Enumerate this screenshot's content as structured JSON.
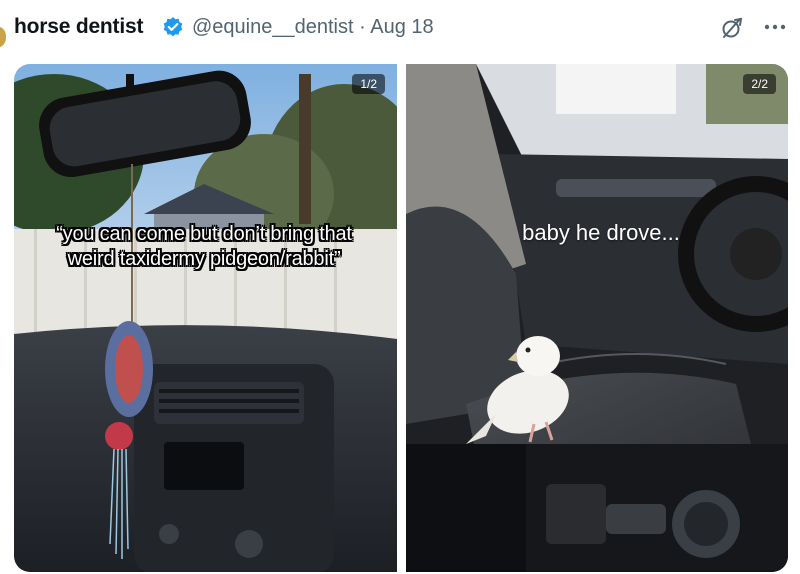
{
  "post": {
    "display_name": "horse dentist",
    "handle": "@equine__dentist",
    "separator": "·",
    "date": "Aug 18",
    "icons": {
      "verified": "verified-badge-icon",
      "grok": "grok-icon",
      "more": "more-options-icon"
    },
    "colors": {
      "verified": "#1d9bf0",
      "handle": "#536471"
    }
  },
  "media": {
    "photos": [
      {
        "counter": "1/2",
        "caption": "“you can come but don’t bring that weird taxidermy pidgeon/rabbit”"
      },
      {
        "counter": "2/2",
        "caption": "baby he drove..."
      }
    ]
  }
}
